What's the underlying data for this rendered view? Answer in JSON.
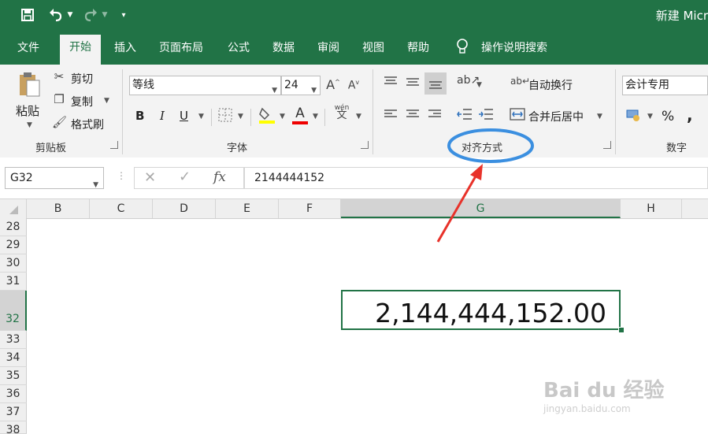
{
  "titlebar": {
    "save_icon": "save-icon",
    "undo_icon": "undo-icon",
    "redo_icon": "redo-icon",
    "customize_icon": "customize-qat-icon",
    "title": "新建 Micr"
  },
  "tabs": [
    "文件",
    "开始",
    "插入",
    "页面布局",
    "公式",
    "数据",
    "审阅",
    "视图",
    "帮助"
  ],
  "active_tab": "开始",
  "tell_me": "操作说明搜索",
  "clipboard": {
    "paste": "粘贴",
    "cut": "剪切",
    "copy": "复制",
    "format_painter": "格式刷",
    "group_label": "剪贴板"
  },
  "font": {
    "font_name": "等线",
    "font_size": "24",
    "bold": "B",
    "italic": "I",
    "underline": "U",
    "font_color_letter": "A",
    "phonetic": "wén",
    "phonetic_char": "文",
    "group_label": "字体"
  },
  "alignment": {
    "wrap_text": "自动换行",
    "merge_center": "合并后居中",
    "group_label": "对齐方式"
  },
  "number": {
    "format": "会计专用",
    "percent": "%",
    "comma": ",",
    "group_label": "数字"
  },
  "formula_bar": {
    "name_box": "G32",
    "fx": "fx",
    "value": "2144444152"
  },
  "columns": [
    "B",
    "C",
    "D",
    "E",
    "F",
    "G",
    "H"
  ],
  "selected_column": "G",
  "rows": [
    "28",
    "29",
    "30",
    "31",
    "32",
    "33",
    "34",
    "35",
    "36",
    "37",
    "38"
  ],
  "selected_row": "32",
  "active_cell_display": "2,144,444,152.00",
  "colors": {
    "excel_green": "#217346",
    "annotation_blue": "#3b8fe0",
    "annotation_red": "#e8322a"
  },
  "watermark": {
    "brand": "Bai du 经验",
    "url": "jingyan.baidu.com"
  }
}
